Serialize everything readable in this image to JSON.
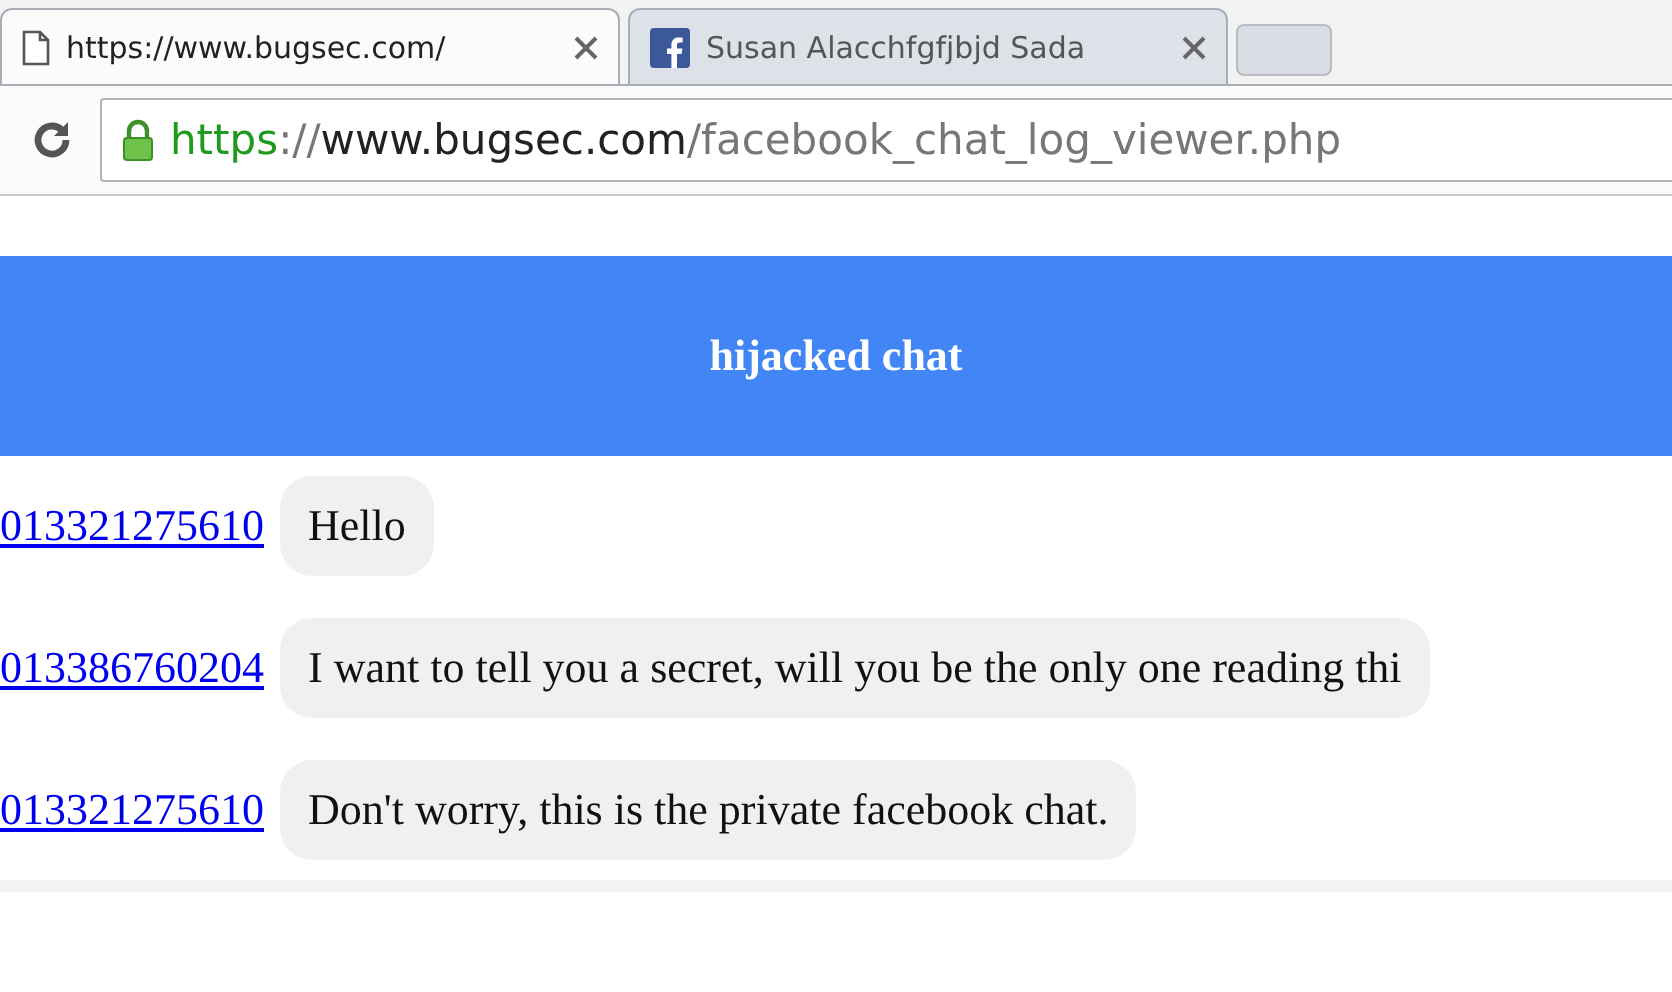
{
  "tabs": [
    {
      "title": "https://www.bugsec.com/",
      "selected": true,
      "kind": "page"
    },
    {
      "title": "Susan Alacchfgfjbjd Sada",
      "selected": false,
      "kind": "facebook"
    }
  ],
  "address": {
    "scheme": "https",
    "separator": "://",
    "host": "www.bugsec.com",
    "path": "/facebook_chat_log_viewer.php"
  },
  "header": "hijacked chat",
  "messages": [
    {
      "sender": "013321275610",
      "text": "Hello"
    },
    {
      "sender": "013386760204",
      "text": "I want to tell you a secret, will you be the only one reading thi"
    },
    {
      "sender": "013321275610",
      "text": "Don't worry, this is the private facebook chat."
    }
  ]
}
